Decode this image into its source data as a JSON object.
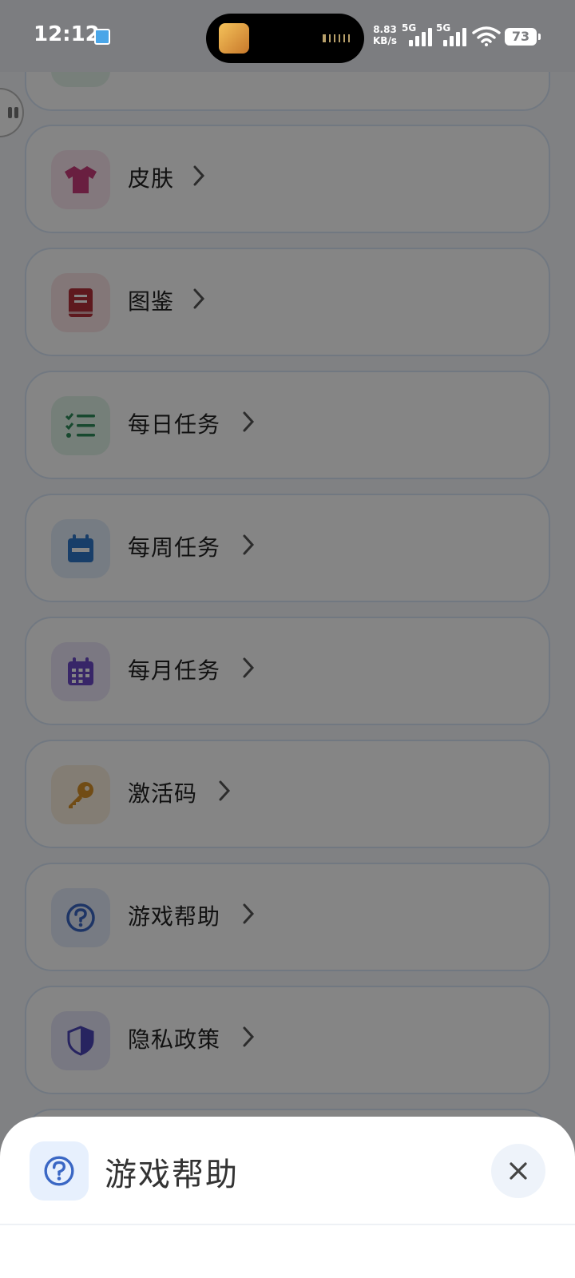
{
  "status": {
    "time": "12:12",
    "speed_value": "8.83",
    "speed_unit": "KB/s",
    "network1": "5G",
    "network2": "5G",
    "battery": "73"
  },
  "menu": {
    "items": [
      {
        "label": "",
        "icon": "partial-icon",
        "color": "#2f9e67"
      },
      {
        "label": "皮肤",
        "icon": "tshirt-icon",
        "color": "#c93c7b"
      },
      {
        "label": "图鉴",
        "icon": "book-icon",
        "color": "#b5303a"
      },
      {
        "label": "每日任务",
        "icon": "checklist-icon",
        "color": "#2e8c5a"
      },
      {
        "label": "每周任务",
        "icon": "calendar-icon",
        "color": "#2f77c9"
      },
      {
        "label": "每月任务",
        "icon": "calendar-grid-icon",
        "color": "#6b49c7"
      },
      {
        "label": "激活码",
        "icon": "key-icon",
        "color": "#d8922a"
      },
      {
        "label": "游戏帮助",
        "icon": "help-icon",
        "color": "#3a67c4"
      },
      {
        "label": "隐私政策",
        "icon": "shield-icon",
        "color": "#4c46b8"
      }
    ]
  },
  "sheet": {
    "title": "游戏帮助",
    "icon": "help-icon",
    "close_icon": "close-icon"
  }
}
